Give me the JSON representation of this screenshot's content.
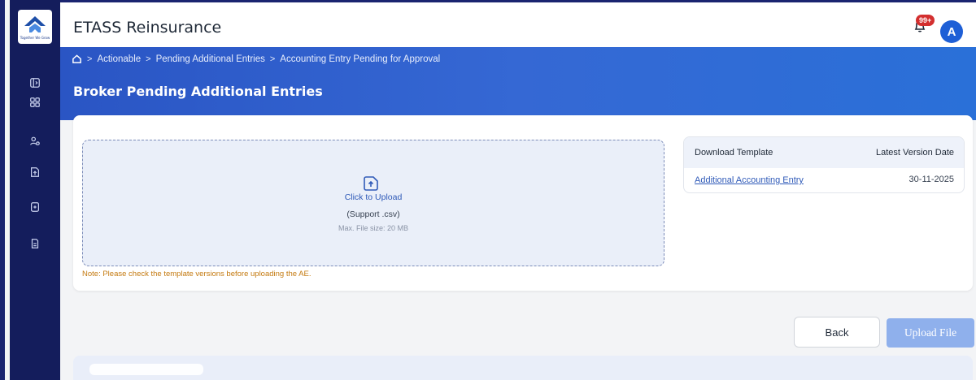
{
  "app": {
    "title": "ETASS Reinsurance",
    "logo_tagline": "Together We Grow"
  },
  "header": {
    "notification_count": "99+",
    "avatar_initial": "A"
  },
  "breadcrumb": {
    "items": [
      "Actionable",
      "Pending Additional Entries",
      "Accounting Entry Pending for Approval"
    ]
  },
  "page": {
    "title": "Broker Pending Additional Entries"
  },
  "sidebar": {
    "icons": [
      "panel-toggle-icon",
      "dashboard-grid-icon",
      "users-icon",
      "upload-file-icon",
      "document-add-icon",
      "document-icon"
    ]
  },
  "upload": {
    "link_label": "Click to Upload",
    "support_text": "(Support .csv)",
    "max_size_text": "Max. File size: 20 MB",
    "note": "Note: Please check the template versions before uploading the AE."
  },
  "template_table": {
    "columns": [
      "Download Template",
      "Latest Version Date"
    ],
    "rows": [
      {
        "name": "Additional Accounting Entry",
        "date": "30-11-2025"
      }
    ]
  },
  "actions": {
    "back_label": "Back",
    "upload_label": "Upload File"
  },
  "colors": {
    "sidebar": "#141d5c",
    "accent": "#2a55c4",
    "note": "#c47a10",
    "upload_button": "#8fb0ec"
  }
}
